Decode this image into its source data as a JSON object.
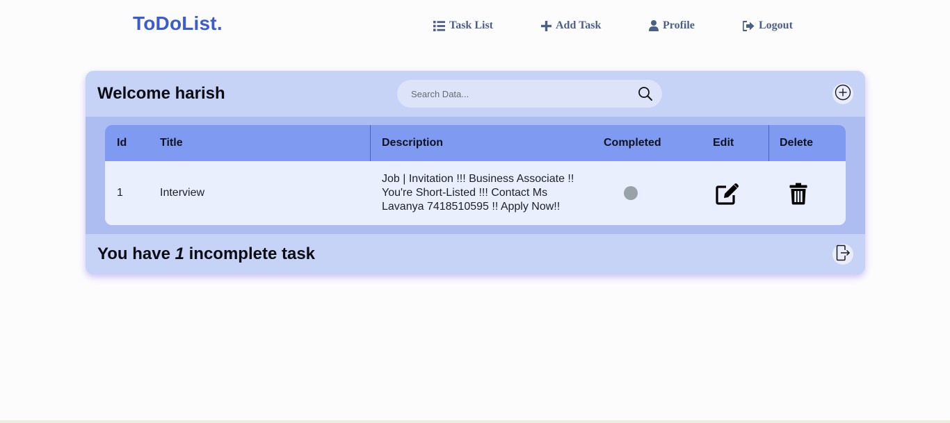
{
  "brand": {
    "name": "ToDoList."
  },
  "nav": {
    "task_list": "Task List",
    "add_task": "Add Task",
    "profile": "Profile",
    "logout": "Logout"
  },
  "header": {
    "welcome": "Welcome harish",
    "search_placeholder": "Search Data..."
  },
  "table": {
    "columns": [
      "Id",
      "Title",
      "Description",
      "Completed",
      "Edit",
      "Delete"
    ],
    "rows": [
      {
        "id": "1",
        "title": "Interview",
        "description": "Job | Invitation !!! Business Associate !! You're Short-Listed !!! Contact Ms Lavanya 7418510595 !! Apply Now!!",
        "completed": false
      }
    ]
  },
  "footer": {
    "prefix": "You have ",
    "count": "1",
    "suffix": " incomplete task"
  },
  "colors": {
    "brand": "#3b5bd0",
    "card_bg": "#adbdf2",
    "header_bg": "#c6d2f6",
    "table_head": "#7f9bf1",
    "row_bg": "#eaeffd",
    "status_incomplete": "#98a3a9"
  }
}
